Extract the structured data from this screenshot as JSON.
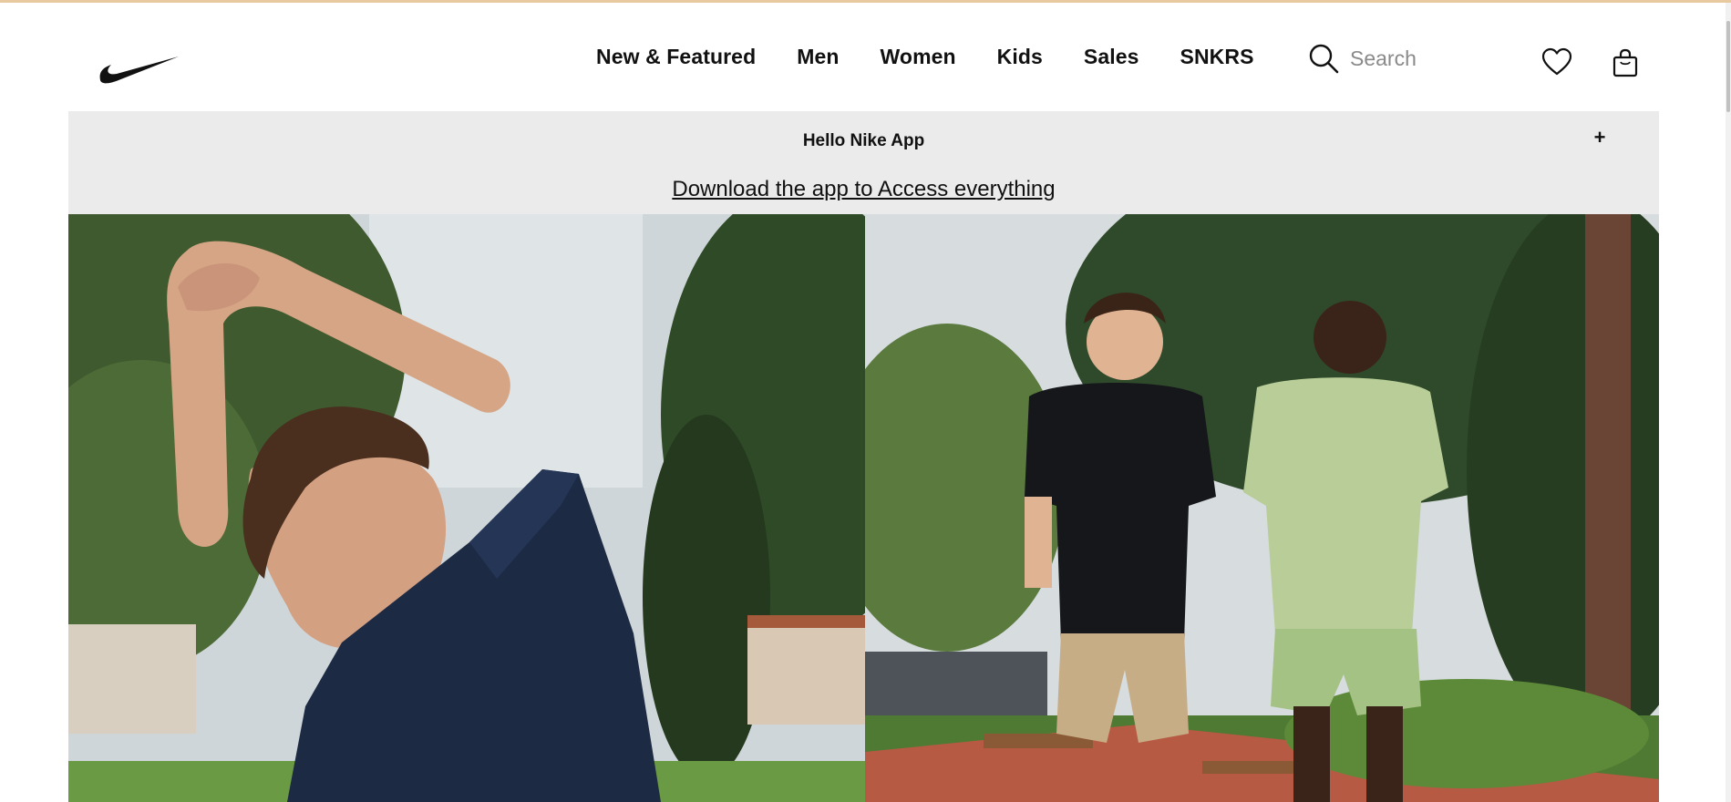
{
  "header": {
    "logo_name": "Nike",
    "nav": [
      "New & Featured",
      "Men",
      "Women",
      "Kids",
      "Sales",
      "SNKRS"
    ],
    "search": {
      "placeholder": "Search",
      "value": ""
    },
    "icons": {
      "search": "search-icon",
      "favorites": "heart-icon",
      "bag": "shopping-bag-icon"
    }
  },
  "banner": {
    "title": "Hello Nike App",
    "expand_symbol": "+",
    "link": "Download the app to Access everything"
  },
  "hero": {
    "left_image": "Person stretching arms overhead in a park, wearing a navy t-shirt",
    "right_image": "Two runners jogging on a park path, black and pale-green outfits"
  },
  "colors": {
    "banner_bg": "#ebebeb",
    "text": "#111111",
    "top_strip": "#e8c9a0"
  }
}
